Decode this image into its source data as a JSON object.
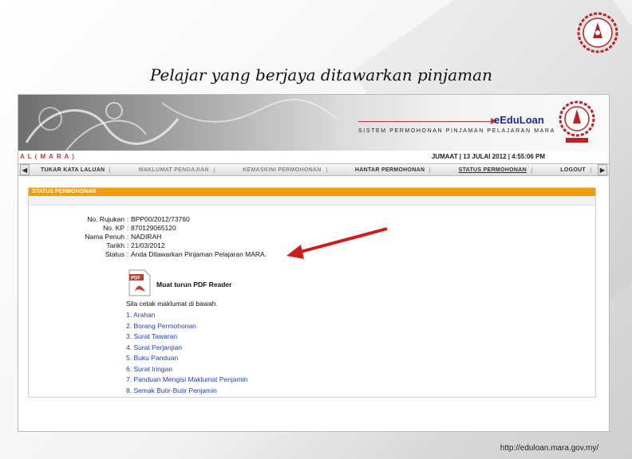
{
  "slide": {
    "title": "Pelajar yang berjaya ditawarkan pinjaman",
    "footer_url": "http://eduloan.mara.gov.my/"
  },
  "banner": {
    "brand_name": "eEduLoan",
    "brand_subtitle": "SISTEM PERMOHONAN PINJAMAN PELAJARAN MARA",
    "organisation": "A L  ( M A R A )",
    "date_time": "JUMAAT | 13 JULAI 2012 | 4:55:06 PM"
  },
  "nav": {
    "items": [
      {
        "label": "TUKAR KATA LALUAN",
        "state": "normal"
      },
      {
        "label": "MAKLUMAT PENGAJIAN",
        "state": "dim"
      },
      {
        "label": "KEMASKINI PERMOHONAN",
        "state": "dim"
      },
      {
        "label": "HANTAR PERMOHONAN",
        "state": "normal"
      },
      {
        "label": "STATUS PERMOHONAN",
        "state": "active"
      },
      {
        "label": "LOGOUT",
        "state": "normal"
      }
    ]
  },
  "status_panel": {
    "header": "STATUS PERMOHONAN",
    "rows": [
      {
        "label": "No. Rujukan",
        "value": "BPP00/2012/73760"
      },
      {
        "label": "No. KP",
        "value": "870129065120"
      },
      {
        "label": "Nama Penuh",
        "value": "NADIRAH"
      },
      {
        "label": "Tarikh",
        "value": "21/03/2012"
      },
      {
        "label": "Status",
        "value": "Anda Ditawarkan Pinjaman Pelajaran MARA."
      }
    ],
    "pdf_label": "Muat turun PDF Reader",
    "instruction": "Sila cetak maklumat di bawah.",
    "documents": [
      "1. Arahan",
      "2. Borang Permohonan",
      "3. Surat Tawaran",
      "4. Surat Perjanjian",
      "5. Buku Panduan",
      "6. Surat Iringan",
      "7. Panduan Mengisi Maklumat Penjamin",
      "8. Semak Butir-Butir Penjamin"
    ]
  },
  "colors": {
    "accent_orange": "#f39c12",
    "link_blue": "#1f3fbf",
    "arrow_red": "#d11a1a",
    "brand_blue": "#1b2b8a"
  }
}
